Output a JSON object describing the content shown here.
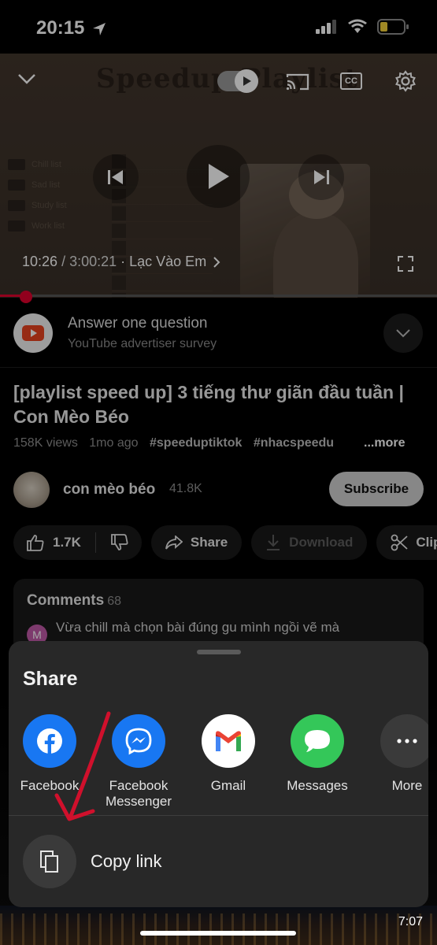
{
  "status_bar": {
    "time": "20:15"
  },
  "player": {
    "thumbnail_title": "Speedup Playlist",
    "thumbnail_folders": [
      "Chill list",
      "Sad list",
      "Study list",
      "Work list"
    ],
    "current_time": "10:26",
    "duration": "/ 3:00:21",
    "chapter": "· Lạc Vào Em",
    "cc_label": "CC",
    "progress_fraction": 0.06
  },
  "survey": {
    "title": "Answer one question",
    "subtitle": "YouTube advertiser survey"
  },
  "video": {
    "title": "[playlist speed up] 3 tiếng thư giãn đầu tuần | Con Mèo Béo",
    "views": "158K views",
    "age": "1mo ago",
    "tags": [
      "#speeduptiktok",
      "#nhacspeedu"
    ],
    "more": "...more"
  },
  "channel": {
    "name": "con mèo béo",
    "subscribers": "41.8K",
    "subscribe_label": "Subscribe"
  },
  "actions": {
    "likes": "1.7K",
    "share": "Share",
    "download": "Download",
    "clip": "Clip"
  },
  "comments": {
    "heading": "Comments",
    "count": "68",
    "avatar_letter": "M",
    "first_comment": "Vừa chill mà chọn bài đúng gu mình ngồi vẽ mà"
  },
  "share_sheet": {
    "title": "Share",
    "targets": [
      {
        "label": "Facebook",
        "icon": "facebook-icon",
        "color": "#1877f2"
      },
      {
        "label": "Facebook Messenger",
        "icon": "messenger-icon",
        "color": "#1877f2"
      },
      {
        "label": "Gmail",
        "icon": "gmail-icon",
        "color": "#ffffff"
      },
      {
        "label": "Messages",
        "icon": "messages-icon",
        "color": "#34c759"
      },
      {
        "label": "More",
        "icon": "more-icon",
        "color": "#3a3a3a"
      }
    ],
    "copy_link": "Copy link"
  },
  "background_clock": "7:07",
  "colors": {
    "accent_red": "#e1002d",
    "annotation_red": "#d0102c"
  }
}
